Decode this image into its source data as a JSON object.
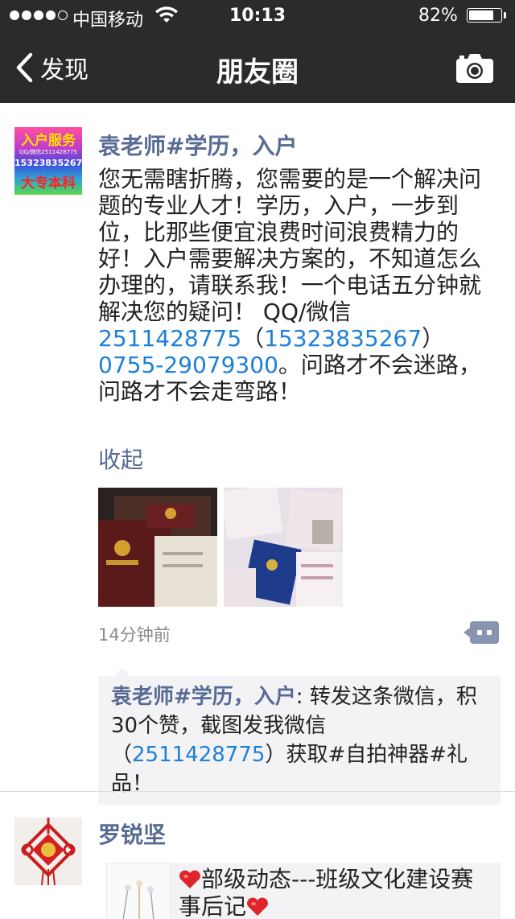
{
  "status_bar": {
    "carrier": "中国移动",
    "time": "10:13",
    "battery_pct": "82%",
    "battery_level": 0.82
  },
  "nav": {
    "back_label": "发现",
    "title": "朋友圈",
    "camera_icon": "camera-icon"
  },
  "posts": [
    {
      "author": "袁老师#学历，入户",
      "avatar_text": [
        "入户服务",
        "QQ/微信2511428775",
        "15323835267",
        "大专本科"
      ],
      "text_before": "您无需瞎折腾，您需要的是一个解决问题的专业人才！学历，入户，一步到位，比那些便宜浪费时间浪费精力的好！入户需要解决方案的，不知道怎么办理的，请联系我！一个电话五分钟就解决您的疑问！ QQ/微信",
      "link1": "2511428775",
      "paren_open": "（",
      "link2": "15323835267",
      "paren_close": "）",
      "link3": "0755-29079300",
      "text_after": "。问路才不会迷路，问路才不会走弯路！",
      "collapse_label": "收起",
      "time": "14分钟前",
      "comment": {
        "author": "袁老师#学历，入户",
        "sep": ": ",
        "text_before": "转发这条微信，积30个赞，截图发我微信（",
        "link": "2511428775",
        "text_after": "）获取#自拍神器#礼品！"
      }
    },
    {
      "author": "罗锐坚",
      "share_title": "部级动态---班级文化建设赛事后记"
    }
  ]
}
